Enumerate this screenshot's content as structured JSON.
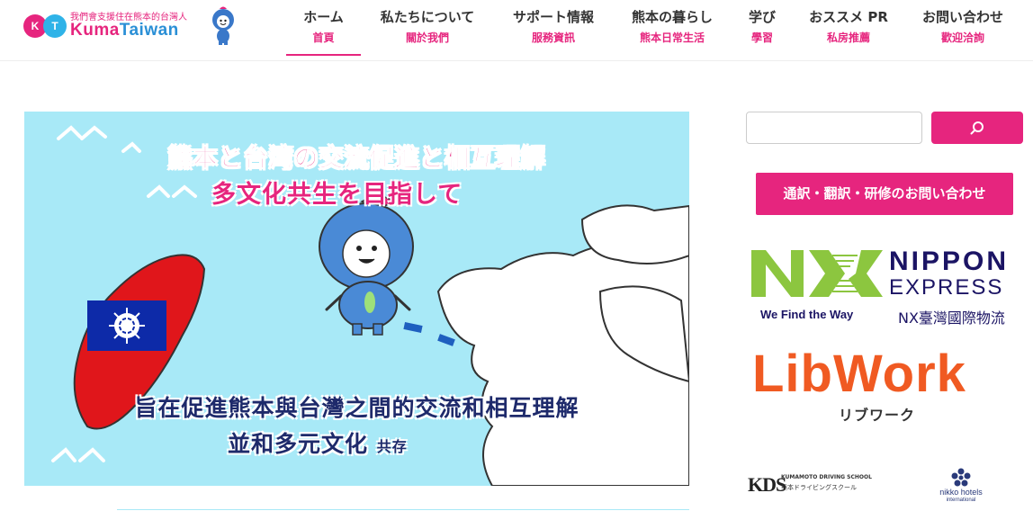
{
  "header": {
    "logo": {
      "badge_k": "K",
      "badge_t": "T",
      "tagline": "我們會支援住在熊本的台灣人",
      "name_part1": "Kuma",
      "name_part2": "Taiwan"
    },
    "nav": [
      {
        "jp": "ホーム",
        "zh": "首頁"
      },
      {
        "jp": "私たちについて",
        "zh": "關於我們"
      },
      {
        "jp": "サポート情報",
        "zh": "服務資訊"
      },
      {
        "jp": "熊本の暮らし",
        "zh": "熊本日常生活"
      },
      {
        "jp": "学び",
        "zh": "學習"
      },
      {
        "jp": "おススメ PR",
        "zh": "私房推薦"
      },
      {
        "jp": "お問い合わせ",
        "zh": "歡迎洽詢"
      }
    ]
  },
  "hero": {
    "line1": "熊本と台湾の交流促進と相互理解",
    "line2": "多文化共生を目指して",
    "line3": "旨在促進熊本與台灣之間的交流和相互理解",
    "line4_main": "並和多元文化",
    "line4_small": "共存"
  },
  "sidebar": {
    "search_placeholder": "",
    "search_icon": "search-icon",
    "contact_button": "通訳・翻訳・研修のお問い合わせ",
    "ads": {
      "nx": {
        "name1": "NIPPON",
        "name2": "EXPRESS",
        "tagline": "We Find the Way",
        "local_name": "NX臺灣國際物流"
      },
      "libwork": {
        "name": "LibWork",
        "kana": "リブワーク"
      },
      "kds": {
        "mark": "KDS",
        "line1": "KUMAMOTO DRIVING SCHOOL",
        "line2": "熊本ドライビングスクール"
      },
      "nikko": {
        "name": "nikko hotels",
        "sub": "international"
      }
    }
  },
  "colors": {
    "accent": "#e6257e",
    "hero_bg": "#a8e9f7",
    "nx_green": "#8cc63f",
    "nx_navy": "#1b1464",
    "libwork_orange": "#f05a22",
    "taiwan_red": "#e0161b",
    "taiwan_blue": "#0d2aa8"
  }
}
